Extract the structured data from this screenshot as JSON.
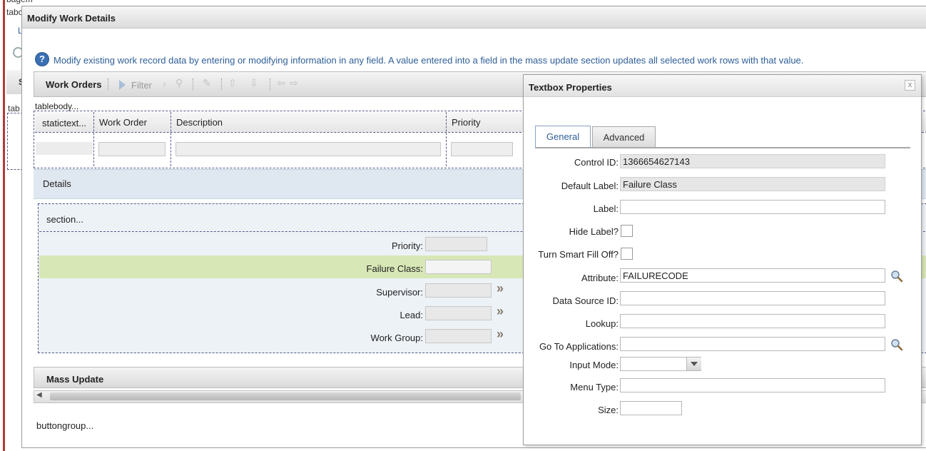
{
  "background": {
    "frag_top": "bagem",
    "frag_tab1": "tabc",
    "frag_l": "L",
    "frag_s": "S",
    "frag_tab2": "tab"
  },
  "dialog": {
    "title": "Modify Work Details",
    "info": "Modify existing work record data by entering or modifying information in any field. A value entered into a field in the mass update section updates all selected work rows with that value.",
    "toolbar": {
      "title": "Work Orders",
      "filter": "Filter"
    },
    "tablebody": "tablebody...",
    "columns": [
      "statictext...",
      "Work Order",
      "Description",
      "Priority"
    ],
    "details": {
      "title": "Details",
      "section": "section...",
      "fields": [
        {
          "label": "Priority:"
        },
        {
          "label": "Failure Class:"
        },
        {
          "label": "Supervisor:"
        },
        {
          "label": "Lead:"
        },
        {
          "label": "Work Group:"
        }
      ]
    },
    "mass_update": "Mass Update",
    "buttongroup": "buttongroup..."
  },
  "textbox_properties": {
    "title": "Textbox Properties",
    "close": "x",
    "tabs": [
      "General",
      "Advanced"
    ],
    "active_tab": "General",
    "fields": {
      "control_id": {
        "label": "Control ID:",
        "value": "1366654627143"
      },
      "default_label": {
        "label": "Default Label:",
        "value": "Failure Class"
      },
      "label": {
        "label": "Label:",
        "value": ""
      },
      "hide_label": {
        "label": "Hide Label?",
        "checked": false
      },
      "smart_fill": {
        "label": "Turn Smart Fill Off?",
        "checked": false
      },
      "attribute": {
        "label": "Attribute:",
        "value": "FAILURECODE"
      },
      "data_source_id": {
        "label": "Data Source ID:",
        "value": ""
      },
      "lookup": {
        "label": "Lookup:",
        "value": ""
      },
      "go_to_apps": {
        "label": "Go To Applications:",
        "value": ""
      },
      "input_mode": {
        "label": "Input Mode:",
        "value": ""
      },
      "menu_type": {
        "label": "Menu Type:",
        "value": ""
      },
      "size": {
        "label": "Size:",
        "value": ""
      }
    }
  },
  "colors": {
    "highlight_row": "#d8e7b6",
    "accent": "#2e5e97",
    "section_bg": "#edf2f7"
  }
}
